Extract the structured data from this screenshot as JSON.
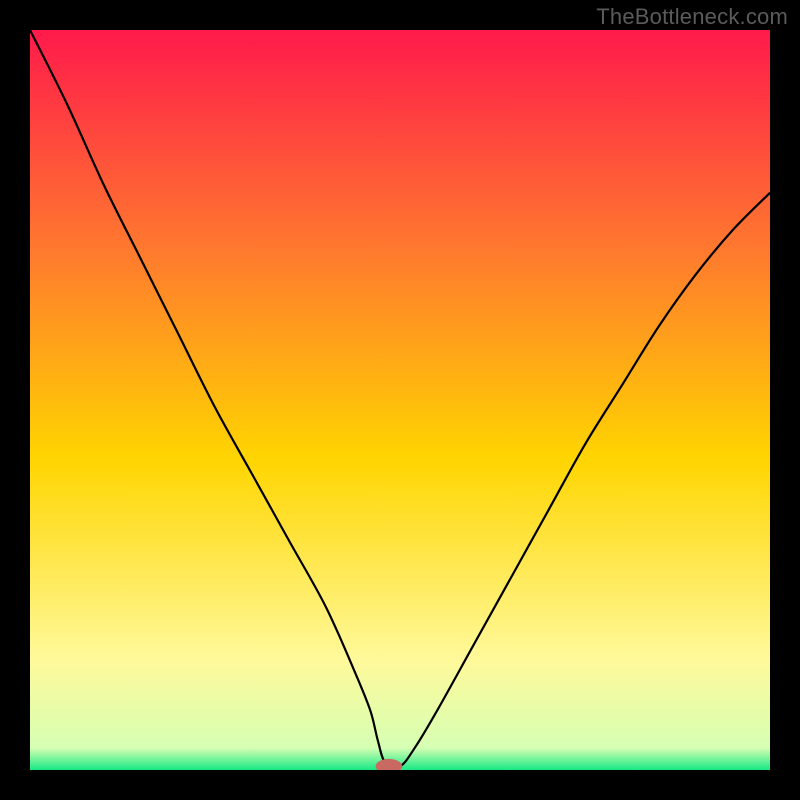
{
  "watermark": "TheBottleneck.com",
  "chart_data": {
    "type": "line",
    "title": "",
    "xlabel": "",
    "ylabel": "",
    "xlim": [
      0,
      100
    ],
    "ylim": [
      0,
      100
    ],
    "grid": false,
    "legend": false,
    "background_gradient": {
      "top_color": "#ff1a4b",
      "mid_upper_color": "#ff7a2e",
      "mid_color": "#ffd500",
      "mid_lower_color": "#fff99a",
      "bottom_color": "#17e884"
    },
    "series": [
      {
        "name": "bottleneck-curve",
        "stroke": "#000000",
        "x": [
          0,
          5,
          10,
          15,
          20,
          25,
          30,
          35,
          40,
          44,
          46,
          47,
          48,
          50,
          52,
          55,
          60,
          65,
          70,
          75,
          80,
          85,
          90,
          95,
          100
        ],
        "values": [
          100,
          90,
          79,
          69,
          59,
          49,
          40,
          31,
          22,
          13,
          8,
          4,
          1,
          0.5,
          3,
          8,
          17,
          26,
          35,
          44,
          52,
          60,
          67,
          73,
          78
        ]
      }
    ],
    "marker": {
      "name": "optimal-point",
      "x": 48.5,
      "y": 0.5,
      "rx": 1.8,
      "ry": 1.0,
      "fill": "#c96a62"
    }
  }
}
